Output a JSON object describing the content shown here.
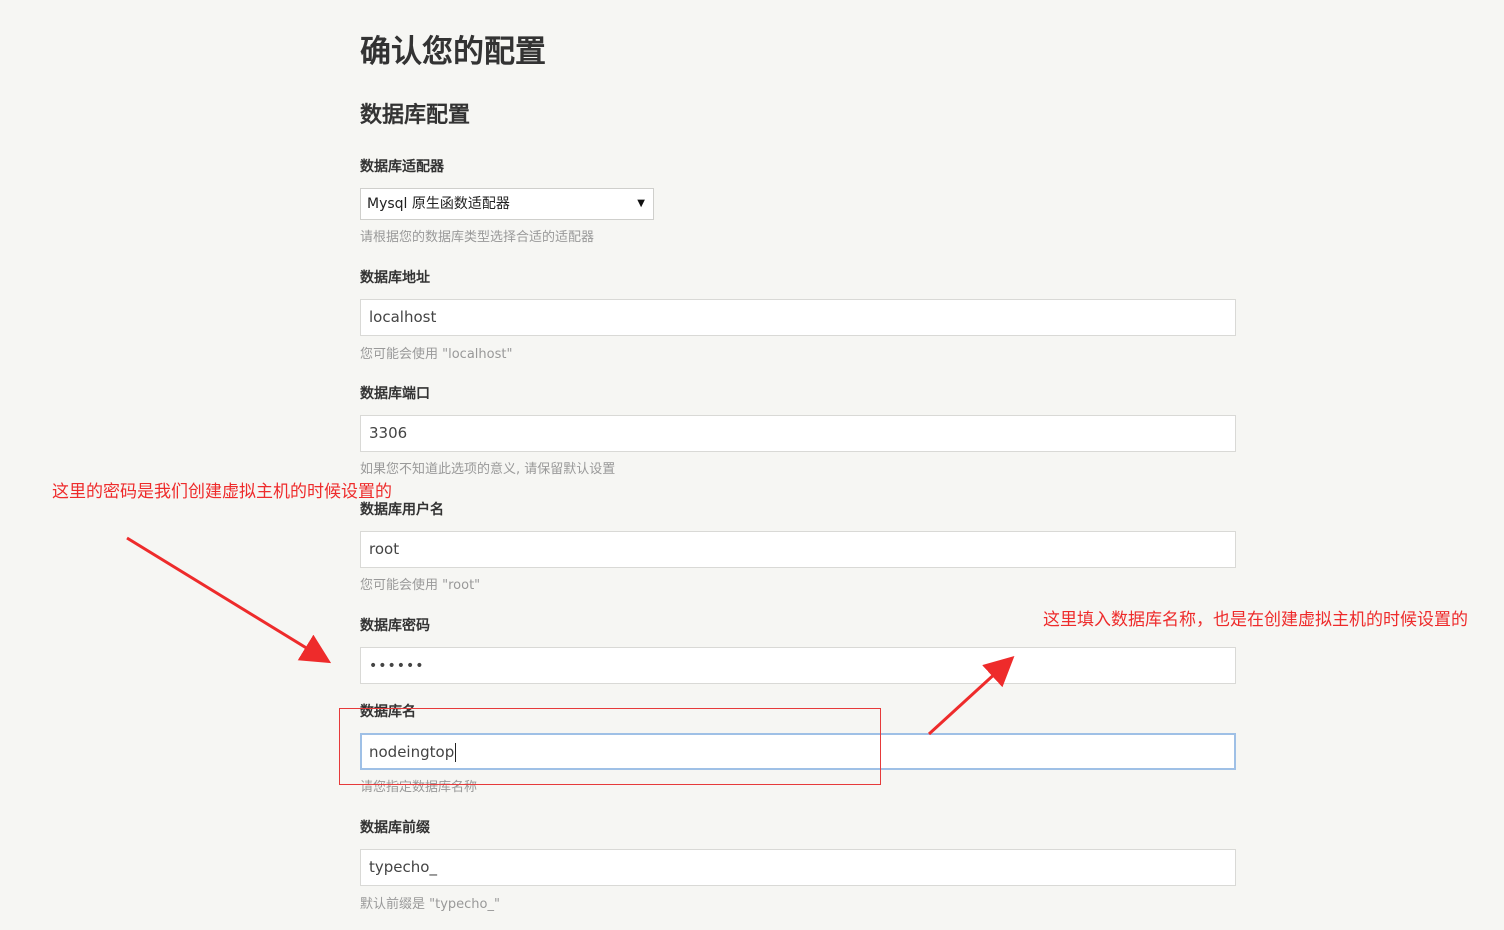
{
  "page": {
    "title": "确认您的配置",
    "section_title": "数据库配置"
  },
  "fields": {
    "adapter": {
      "label": "数据库适配器",
      "selected": "Mysql 原生函数适配器",
      "hint": "请根据您的数据库类型选择合适的适配器"
    },
    "host": {
      "label": "数据库地址",
      "value": "localhost",
      "hint": "您可能会使用 \"localhost\""
    },
    "port": {
      "label": "数据库端口",
      "value": "3306",
      "hint": "如果您不知道此选项的意义, 请保留默认设置"
    },
    "user": {
      "label": "数据库用户名",
      "value": "root",
      "hint": "您可能会使用 \"root\""
    },
    "password": {
      "label": "数据库密码",
      "value": "••••••"
    },
    "dbname": {
      "label": "数据库名",
      "value": "nodeingtop",
      "hint": "请您指定数据库名称"
    },
    "prefix": {
      "label": "数据库前缀",
      "value": "typecho_",
      "hint": "默认前缀是 \"typecho_\""
    }
  },
  "annotations": {
    "left_note": "这里的密码是我们创建虚拟主机的时候设置的",
    "right_note": "这里填入数据库名称，也是在创建虚拟主机的时候设置的",
    "color": "#ee2b2b"
  },
  "icons": {
    "select_arrow": "▼"
  },
  "theme": {
    "background": "#f6f6f3",
    "focus_border": "#9fc0e6"
  }
}
